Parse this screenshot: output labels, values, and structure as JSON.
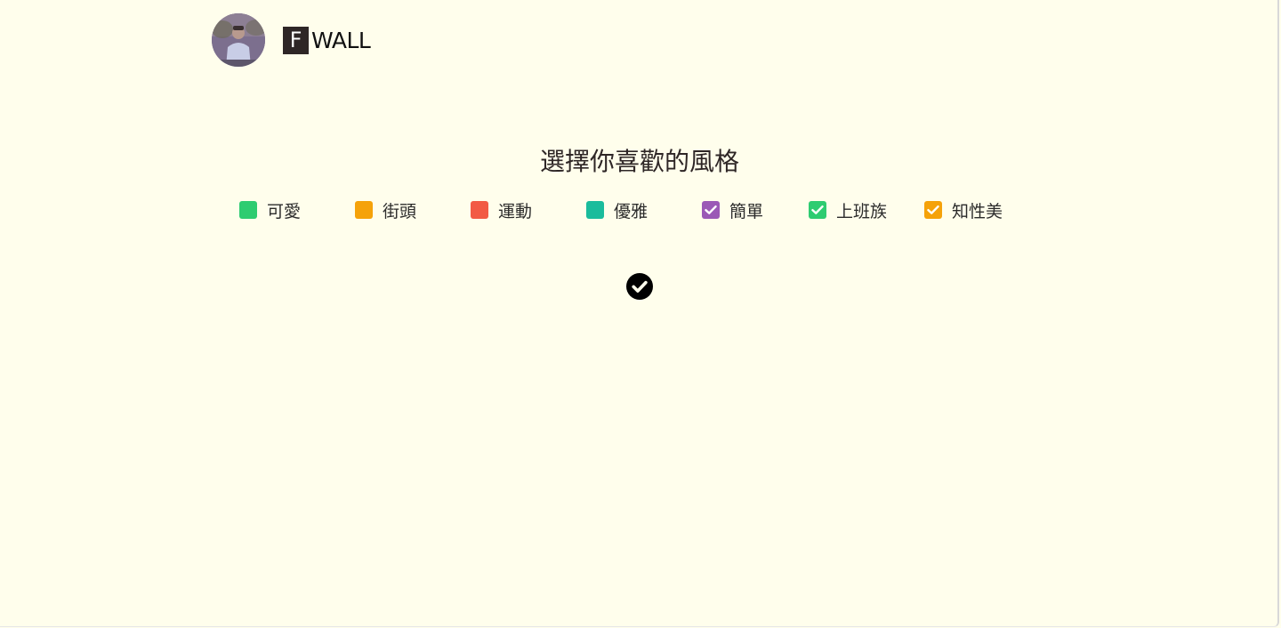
{
  "header": {
    "logo_mark": "F",
    "logo_text": "WALL",
    "avatar_icon": "profile-photo"
  },
  "main": {
    "title": "選擇你喜歡的風格",
    "confirm_icon": "check-circle-icon"
  },
  "styles": [
    {
      "label": "可愛",
      "color": "#2ecc71",
      "checked": false
    },
    {
      "label": "街頭",
      "color": "#f5a20a",
      "checked": false
    },
    {
      "label": "運動",
      "color": "#f25a45",
      "checked": false
    },
    {
      "label": "優雅",
      "color": "#1abc9c",
      "checked": false
    },
    {
      "label": "簡單",
      "color": "#9b59b6",
      "checked": true
    },
    {
      "label": "上班族",
      "color": "#2ecc71",
      "checked": true
    },
    {
      "label": "知性美",
      "color": "#f5a20a",
      "checked": true
    }
  ]
}
